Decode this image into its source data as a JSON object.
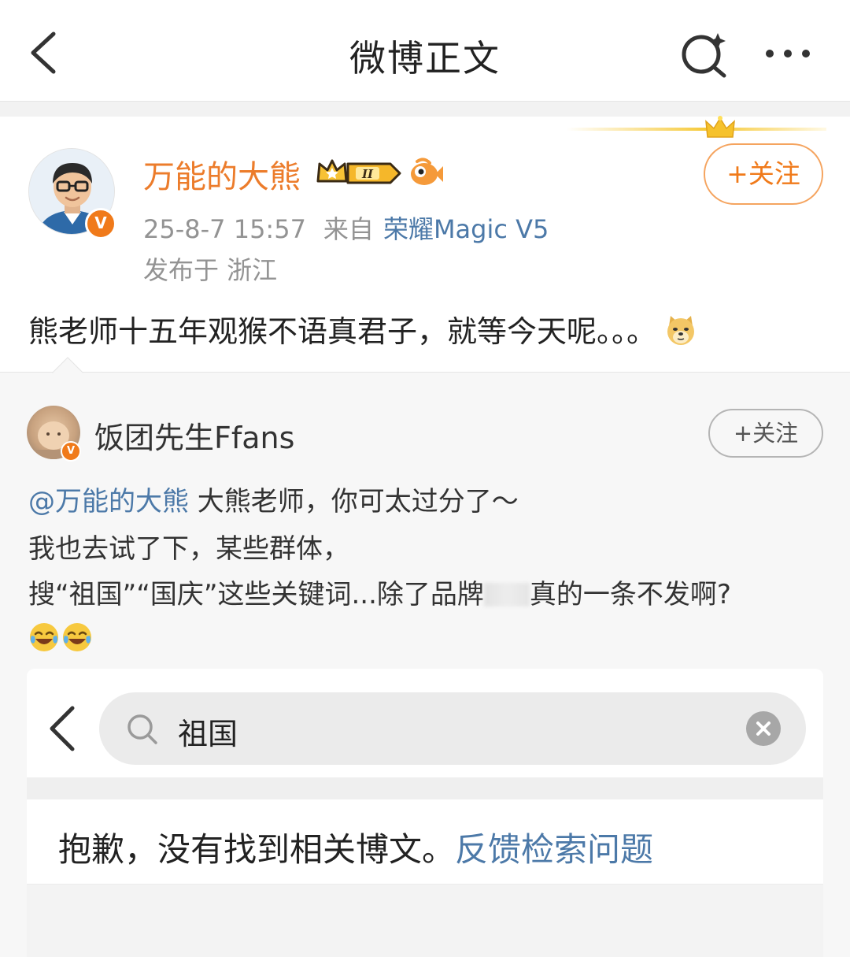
{
  "header": {
    "title": "微博正文",
    "back_icon": "chevron-left-icon",
    "search_icon": "sparkle-search-icon",
    "more_icon": "more-dots-icon"
  },
  "post": {
    "author": {
      "name": "万能的大熊",
      "verified_label": "V",
      "name_color": "#ec7c2b",
      "member_level": "II"
    },
    "follow_label": "+关注",
    "time": "25-8-7 15:57",
    "from_label": "来自",
    "device": "荣耀Magic V5",
    "location": "发布于 浙江",
    "text": "熊老师十五年观猴不语真君子，就等今天呢。。。"
  },
  "repost": {
    "author": {
      "name": "饭团先生Ffans",
      "verified_label": "V"
    },
    "follow_label": "+关注",
    "mention": "@万能的大熊",
    "line1_rest": " 大熊老师，你可太过分了～",
    "line2": "我也去试了下，某些群体，",
    "line3_a": "搜“祖国”“国庆”这些关键词...除了品牌",
    "line3_b": "真的一条不发啊?",
    "emoji_count": 2
  },
  "screenshot": {
    "search_value": "祖国",
    "no_result_text": "抱歉，没有找到相关博文。",
    "feedback_link": "反馈检索问题"
  },
  "colors": {
    "accent_orange": "#f07a1a",
    "link_blue": "#4c79a8",
    "text_gray": "#939393"
  }
}
